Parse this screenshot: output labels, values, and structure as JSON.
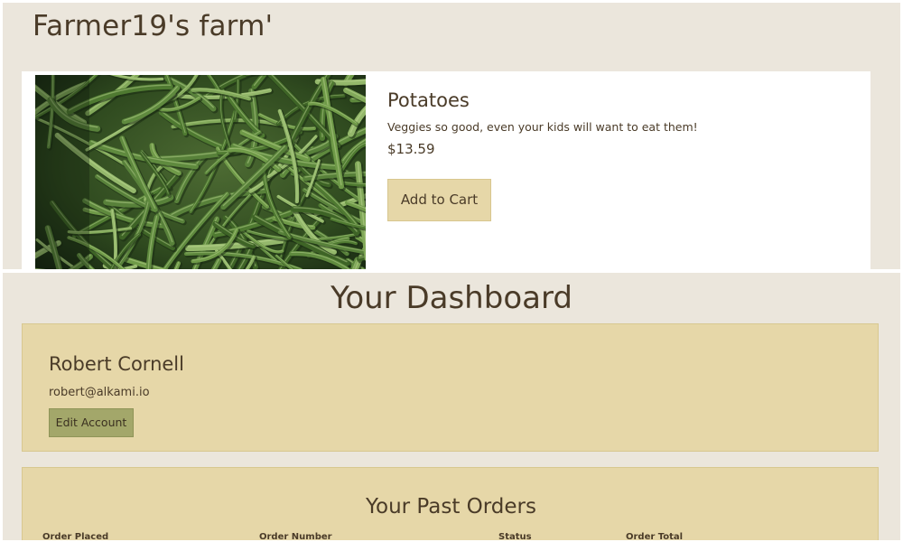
{
  "farm": {
    "title": "Farmer19's farm'"
  },
  "product": {
    "name": "Potatoes",
    "description": "Veggies so good, even your kids will want to eat them!",
    "price": "$13.59",
    "add_to_cart_label": "Add to Cart",
    "image_icon": "green-beans-photo"
  },
  "dashboard": {
    "title": "Your Dashboard",
    "account": {
      "name": "Robert Cornell",
      "email": "robert@alkami.io",
      "edit_label": "Edit Account"
    },
    "orders": {
      "title": "Your Past Orders",
      "columns": [
        "Order Placed",
        "Order Number",
        "Status",
        "Order Total"
      ]
    }
  },
  "colors": {
    "panel_bg": "#ebe6dc",
    "card_tan": "#e6d7a8",
    "button_olive": "#a3a76a",
    "text_brown": "#4a3b28"
  }
}
